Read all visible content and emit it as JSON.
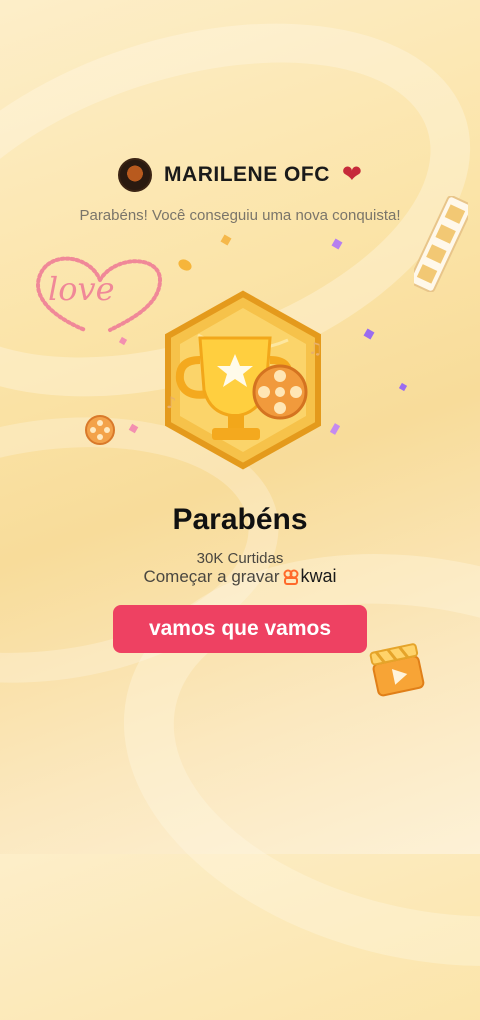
{
  "header": {
    "username": "MARILENE OFC",
    "heart": "❤"
  },
  "subtitle": "Parabéns! Você conseguiu uma nova conquista!",
  "decor": {
    "love_text": "love"
  },
  "achievement": {
    "title": "Parabéns",
    "likes": "30K Curtidas",
    "record_prefix": "Começar a gravar",
    "brand": "kwai"
  },
  "cta": {
    "label": "vamos que vamos"
  },
  "colors": {
    "cta": "#ee4162",
    "heart": "#c62a3a",
    "badge_gold": "#f5b52a"
  }
}
